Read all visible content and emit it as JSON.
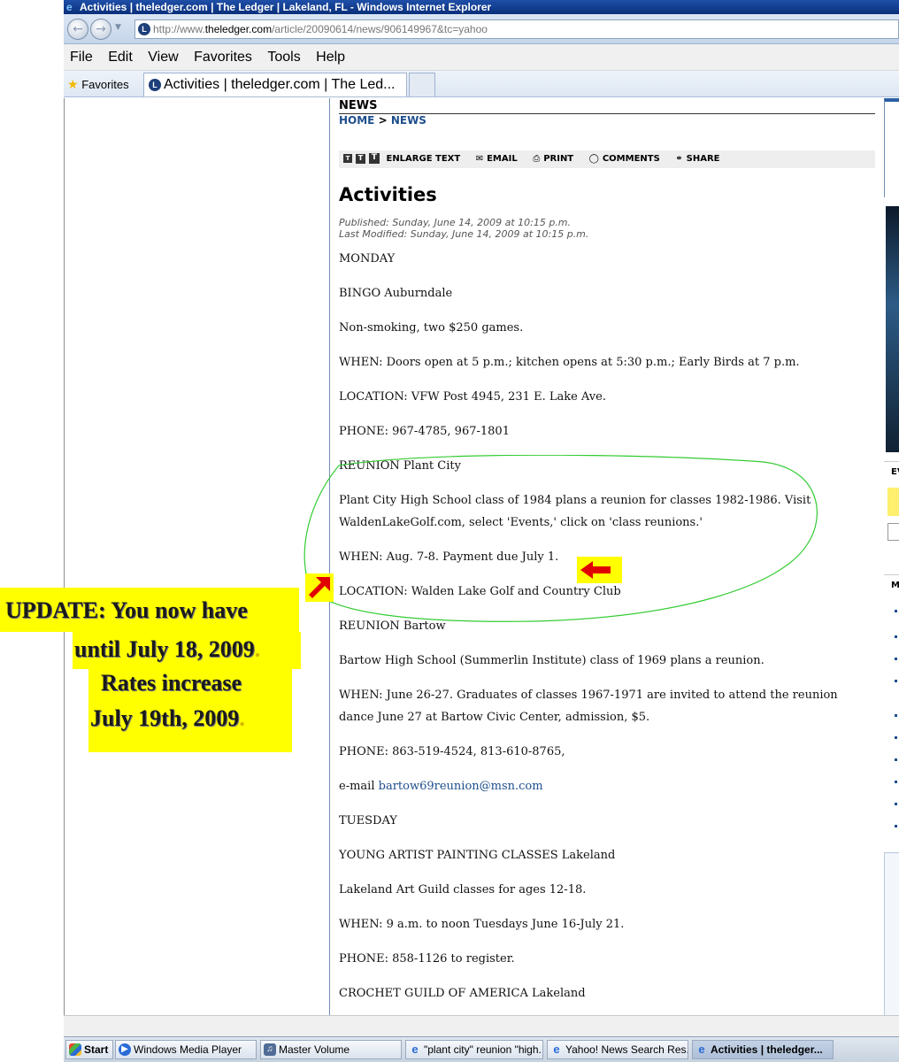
{
  "window": {
    "title": "Activities | theledger.com | The Ledger | Lakeland, FL - Windows Internet Explorer"
  },
  "address_bar": {
    "url_prefix": "http://www.",
    "url_domain": "theledger.com",
    "url_path": "/article/20090614/news/906149967&tc=yahoo"
  },
  "menu": {
    "items": [
      "File",
      "Edit",
      "View",
      "Favorites",
      "Tools",
      "Help"
    ]
  },
  "favorites_bar": {
    "favorites_label": "Favorites",
    "tab_title": "Activities | theledger.com | The Led..."
  },
  "article": {
    "section": "NEWS",
    "breadcrumb": {
      "home": "HOME",
      "sep": ">",
      "current": "NEWS"
    },
    "tools": {
      "size_small": "T",
      "size_medium": "T",
      "size_large": "T",
      "enlarge": "ENLARGE TEXT",
      "email": "EMAIL",
      "print": "PRINT",
      "comments": "COMMENTS",
      "share": "SHARE"
    },
    "title": "Activities",
    "published": "Published: Sunday, June 14, 2009 at 10:15 p.m.",
    "modified": "Last Modified: Sunday, June 14, 2009 at 10:15 p.m.",
    "paragraphs": [
      "MONDAY",
      "BINGO Auburndale",
      "Non-smoking, two $250 games.",
      "WHEN: Doors open at 5 p.m.; kitchen opens at 5:30 p.m.; Early Birds at 7 p.m.",
      "LOCATION: VFW Post 4945, 231 E. Lake Ave.",
      "PHONE: 967-4785, 967-1801",
      "REUNION Plant City",
      "Plant City High School class of 1984 plans a reunion for classes 1982-1986. Visit WaldenLakeGolf.com, select 'Events,' click on 'class reunions.'",
      "WHEN: Aug. 7-8. Payment due July 1.",
      "LOCATION: Walden Lake Golf and Country Club",
      "REUNION Bartow",
      "Bartow High School (Summerlin Institute) class of 1969 plans a reunion.",
      "WHEN: June 26-27. Graduates of classes 1967-1971 are invited to attend the reunion dance June 27 at Bartow Civic Center, admission, $5.",
      "PHONE: 863-519-4524, 813-610-8765,"
    ],
    "email_prefix": "e-mail",
    "email_link": "bartow69reunion@msn.com",
    "paragraphs_after": [
      "TUESDAY",
      "YOUNG ARTIST PAINTING CLASSES Lakeland",
      "Lakeland Art Guild classes for ages 12-18.",
      "WHEN: 9 a.m. to noon Tuesdays June 16-July 21.",
      "PHONE: 858-1126 to register.",
      "CROCHET GUILD OF AMERICA Lakeland"
    ]
  },
  "right_panel": {
    "ev_label": "EV",
    "m_label": "M"
  },
  "annotation": {
    "line1_a": "UPDATE",
    "line1_b": ": You now have",
    "line2": "until July 18, 2009",
    "line2_end": ".",
    "line3": "Rates increase",
    "line4": "July 19th, 2009",
    "line4_end": ".",
    "color_highlight": "#ffff00",
    "color_arrow": "#e00000",
    "color_circle": "#33cc33"
  },
  "taskbar": {
    "start": "Start",
    "items": [
      "Windows Media Player",
      "Master Volume",
      "\"plant city\" reunion \"high...",
      "Yahoo! News Search Res...",
      "Activities | theledger..."
    ]
  }
}
